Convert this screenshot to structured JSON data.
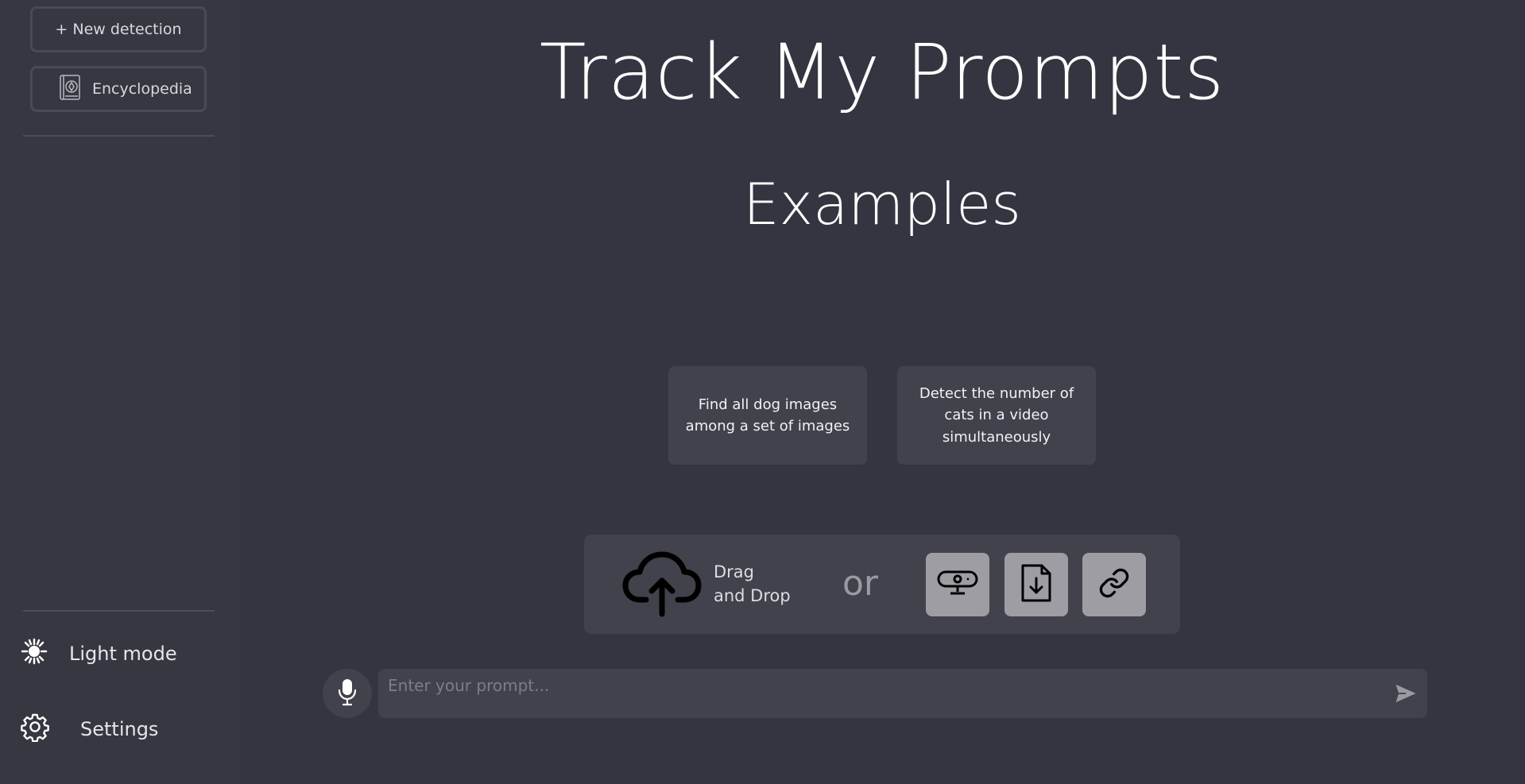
{
  "sidebar": {
    "new_detection_label": "+ New detection",
    "encyclopedia_label": "Encyclopedia",
    "light_mode_label": "Light mode",
    "settings_label": "Settings"
  },
  "main": {
    "title": "Track My Prompts",
    "examples_heading": "Examples",
    "examples": [
      {
        "text": "Find all dog images among a set of images"
      },
      {
        "text": "Detect the number of cats in a video simultaneously"
      }
    ],
    "upload": {
      "drag_line1": "Drag",
      "drag_line2": "and Drop",
      "or_label": "or",
      "icons": [
        "cloud-upload-icon",
        "webcam-icon",
        "file-download-icon",
        "link-icon"
      ]
    },
    "prompt": {
      "placeholder": "Enter your prompt...",
      "value": ""
    }
  },
  "colors": {
    "background": "#343540",
    "sidebar": "#363741",
    "card": "#41424c",
    "tool_button": "#9d9da3"
  }
}
